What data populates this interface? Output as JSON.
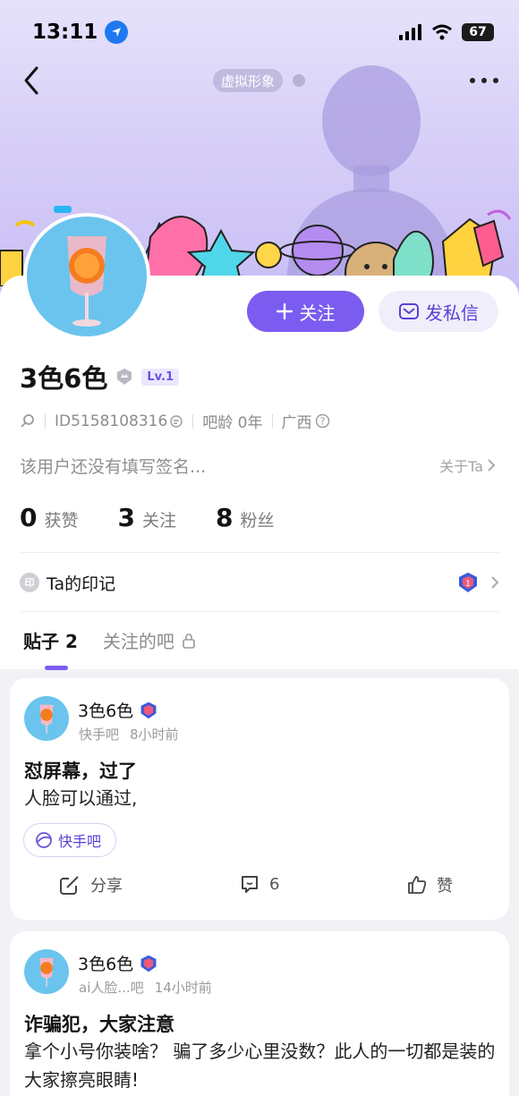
{
  "status_bar": {
    "time": "13:11",
    "battery": "67"
  },
  "header": {
    "virtual_tag": "虚拟形象"
  },
  "profile": {
    "username": "3色6色",
    "level": "Lv.1",
    "id_label": "ID",
    "id_value": "5158108316",
    "bar_age": "吧龄 0年",
    "location": "广西",
    "signature": "该用户还没有填写签名...",
    "about_link": "关于Ta",
    "follow_label": "关注",
    "message_label": "发私信"
  },
  "stats": [
    {
      "num": "0",
      "label": "获赞"
    },
    {
      "num": "3",
      "label": "关注"
    },
    {
      "num": "8",
      "label": "粉丝"
    }
  ],
  "marks": {
    "icon_text": "印",
    "label": "Ta的印记"
  },
  "tabs": {
    "posts_label": "贴子",
    "posts_count": "2",
    "followed_bars_label": "关注的吧"
  },
  "posts": [
    {
      "author": "3色6色",
      "forum": "快手吧",
      "time": "8小时前",
      "title": "怼屏幕，过了",
      "body": "人脸可以通过,",
      "forum_tag": "快手吧",
      "share_label": "分享",
      "comment_count": "6",
      "like_label": "赞"
    },
    {
      "author": "3色6色",
      "forum": "ai人脸...吧",
      "time": "14小时前",
      "title": "诈骗犯，大家注意",
      "body": "拿个小号你装啥？ 骗了多少心里没数？此人的一切都是装的大家擦亮眼睛!"
    }
  ],
  "colors": {
    "accent": "#7b5cf0",
    "header_bg": "#d8d0f8"
  }
}
